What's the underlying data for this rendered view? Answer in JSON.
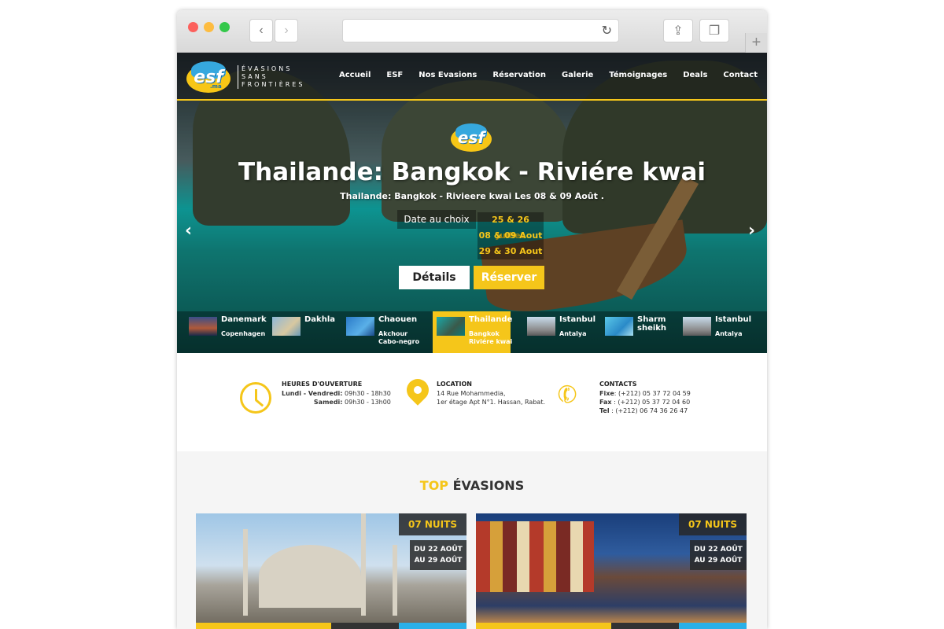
{
  "browser": {
    "url": ""
  },
  "nav": {
    "logo_text": "esf",
    "logo_sub": ".ma",
    "brand_lines": [
      "ÉVASIONS",
      "SANS",
      "FRONTIÈRES"
    ],
    "items": [
      "Accueil",
      "ESF",
      "Nos Evasions",
      "Réservation",
      "Galerie",
      "Témoignages",
      "Deals",
      "Contact"
    ]
  },
  "slider": {
    "logo_text": "esf",
    "title": "Thailande: Bangkok - Riviére kwai",
    "subtitle": "Thailande: Bangkok - Rivieere kwai Les 08 & 09 Août .",
    "date_label": "Date au choix",
    "dates": [
      "25 & 26 Juillet",
      "08 & 09 Aout",
      "29 & 30 Aout"
    ],
    "details_label": "Détails",
    "reserve_label": "Réserver",
    "prev_arrow": "‹",
    "next_arrow": "›"
  },
  "thumbnails": [
    {
      "name": "Danemark",
      "sub1": "Copenhagen",
      "sub2": ""
    },
    {
      "name": "Dakhla",
      "sub1": "",
      "sub2": ""
    },
    {
      "name": "Chaouen",
      "sub1": "Akchour",
      "sub2": "Cabo-negro"
    },
    {
      "name": "Thailande",
      "sub1": "Bangkok",
      "sub2": "Riviére kwai"
    },
    {
      "name": "Istanbul",
      "sub1": "Antalya",
      "sub2": ""
    },
    {
      "name": "Sharm",
      "name2": "sheikh",
      "sub1": "",
      "sub2": ""
    },
    {
      "name": "Istanbul",
      "sub1": "Antalya",
      "sub2": ""
    }
  ],
  "info": {
    "hours": {
      "title": "HEURES D'OUVERTURE",
      "line1_label": "Lundi - Vendredi:",
      "line1_value": "09h30 - 18h30",
      "line2_label": "Samedi:",
      "line2_value": "09h30 - 13h00"
    },
    "location": {
      "title": "LOCATION",
      "line1": "14 Rue Mohammedia,",
      "line2": "1er étage Apt N°1. Hassan, Rabat."
    },
    "contacts": {
      "title": "CONTACTS",
      "fixe_label": "Fixe",
      "fixe": ": (+212) 05 37 72 04 59",
      "fax_label": "Fax",
      "fax": ": (+212) 05 37 72 04 60",
      "tel_label": "Tel",
      "tel": " : (+212) 06 74 36 26 47"
    }
  },
  "top": {
    "title_highlight": "TOP",
    "title_rest": "ÉVASIONS",
    "cards": [
      {
        "nights": "07 NUITS",
        "date1": "DU 22 AOÛT",
        "date2": "AU 29 AOÛT"
      },
      {
        "nights": "07 NUITS",
        "date1": "DU 22 AOÛT",
        "date2": "AU 29 AOÛT"
      }
    ]
  }
}
